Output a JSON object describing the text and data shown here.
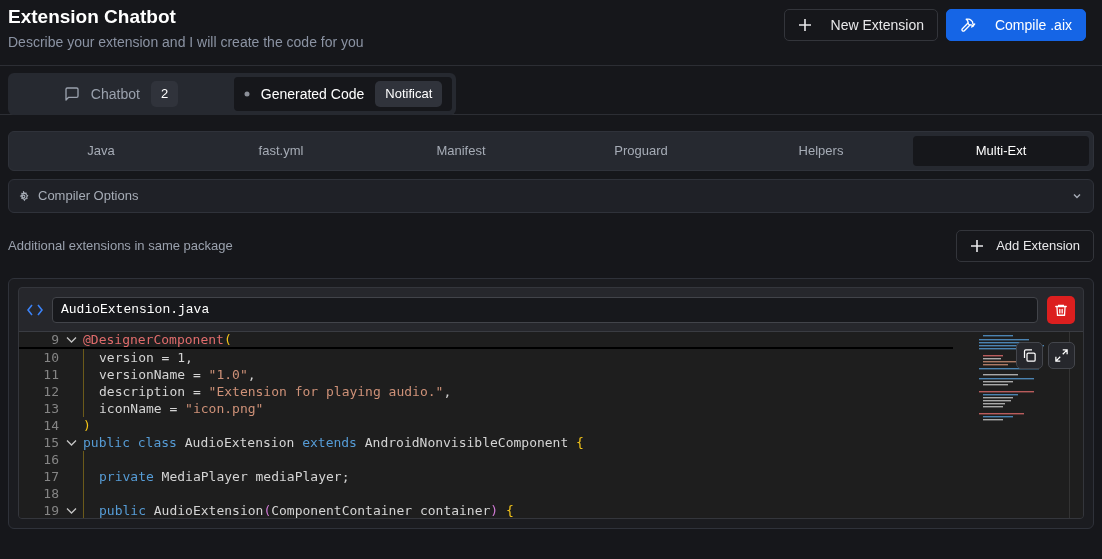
{
  "header": {
    "title": "Extension Chatbot",
    "subtitle": "Describe your extension and I will create the code for you",
    "buttons": [
      {
        "kind": "new",
        "label": "New Extension"
      },
      {
        "kind": "compile",
        "label": "Compile .aix"
      }
    ]
  },
  "main_tabs": [
    {
      "label": "Chatbot",
      "badge": "2",
      "selected": false
    },
    {
      "label": "Generated Code",
      "badge": "Notificat",
      "selected": true
    }
  ],
  "file_tabs": [
    {
      "label": "Java",
      "selected": false
    },
    {
      "label": "fast.yml",
      "selected": false
    },
    {
      "label": "Manifest",
      "selected": false
    },
    {
      "label": "Proguard",
      "selected": false
    },
    {
      "label": "Helpers",
      "selected": false
    },
    {
      "label": "Multi-Ext",
      "selected": true
    }
  ],
  "compiler_options": {
    "label": "Compiler Options",
    "expanded": false
  },
  "section": {
    "label": "Additional extensions in same package",
    "button": "Add Extension"
  },
  "extension": {
    "filename": "AudioExtension.java",
    "sticky_line": {
      "number": "9",
      "fold": true,
      "tokens": [
        {
          "kind": "at",
          "text": "@DesignerComponent"
        },
        {
          "kind": "paren",
          "text": "("
        }
      ]
    },
    "lines": [
      {
        "number": "10",
        "fold": false,
        "indent": true,
        "tokens": [
          {
            "kind": "text",
            "text": "version = 1,"
          }
        ]
      },
      {
        "number": "11",
        "fold": false,
        "indent": true,
        "tokens": [
          {
            "kind": "text",
            "text": "versionName = "
          },
          {
            "kind": "str",
            "text": "\"1.0\""
          },
          {
            "kind": "text",
            "text": ","
          }
        ]
      },
      {
        "number": "12",
        "fold": false,
        "indent": true,
        "tokens": [
          {
            "kind": "text",
            "text": "description = "
          },
          {
            "kind": "str",
            "text": "\"Extension for playing audio.\""
          },
          {
            "kind": "text",
            "text": ","
          }
        ]
      },
      {
        "number": "13",
        "fold": false,
        "indent": true,
        "tokens": [
          {
            "kind": "text",
            "text": "iconName = "
          },
          {
            "kind": "str",
            "text": "\"icon.png\""
          }
        ]
      },
      {
        "number": "14",
        "fold": false,
        "indent": false,
        "tokens": [
          {
            "kind": "paren",
            "text": ")"
          }
        ]
      },
      {
        "number": "15",
        "fold": true,
        "indent": false,
        "tokens": [
          {
            "kind": "kw",
            "text": "public class"
          },
          {
            "kind": "text",
            "text": " AudioExtension "
          },
          {
            "kind": "kw",
            "text": "extends"
          },
          {
            "kind": "text",
            "text": " AndroidNonvisibleComponent "
          },
          {
            "kind": "paren",
            "text": "{"
          }
        ]
      },
      {
        "number": "16",
        "fold": false,
        "indent": true
      },
      {
        "number": "17",
        "fold": false,
        "indent": true,
        "tokens": [
          {
            "kind": "kw",
            "text": "private"
          },
          {
            "kind": "text",
            "text": " MediaPlayer mediaPlayer;"
          }
        ]
      },
      {
        "number": "18",
        "fold": false,
        "indent": true
      },
      {
        "number": "19",
        "fold": true,
        "indent": true,
        "tokens": [
          {
            "kind": "kw",
            "text": "public"
          },
          {
            "kind": "text",
            "text": " AudioExtension"
          },
          {
            "kind": "paren2",
            "text": "("
          },
          {
            "kind": "text",
            "text": "ComponentContainer container"
          },
          {
            "kind": "paren2",
            "text": ")"
          },
          {
            "kind": "paren",
            "text": " {"
          }
        ]
      }
    ]
  }
}
